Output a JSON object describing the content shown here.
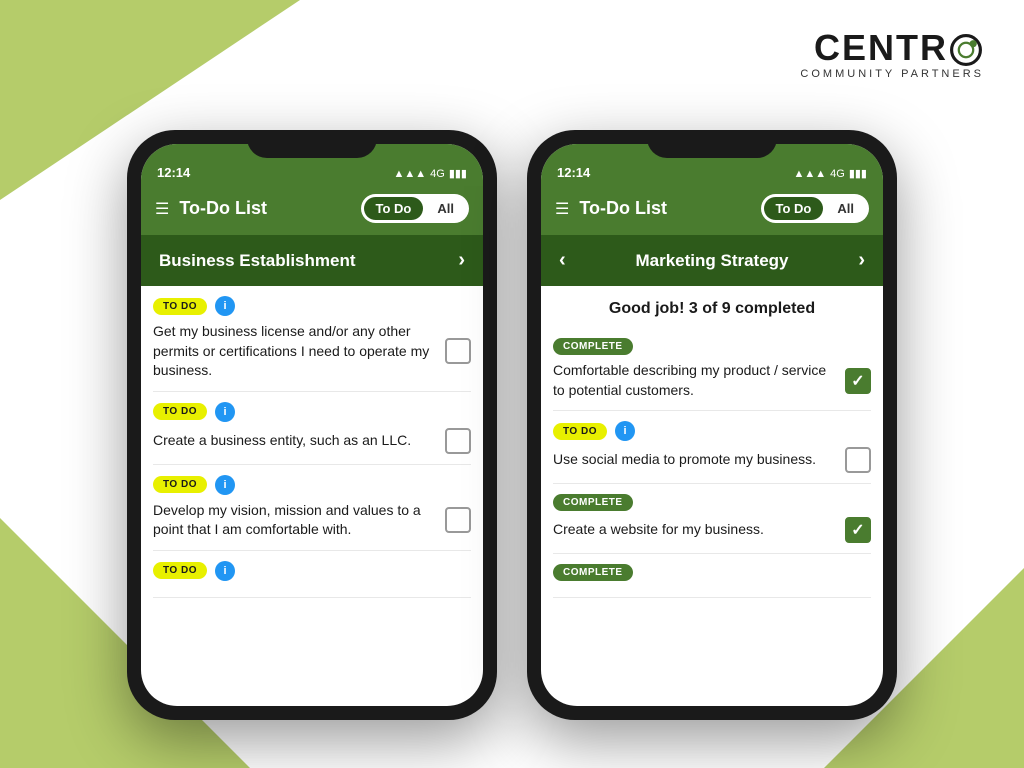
{
  "background": {
    "color": "#ffffff",
    "accent": "#b5cc6a"
  },
  "logo": {
    "text_part1": "CENTR",
    "text_part2": "O",
    "subtitle": "COMMUNITY PARTNERS",
    "accent_color": "#4a7c2f"
  },
  "phone1": {
    "status_time": "12:14",
    "status_signal": "4G",
    "header_title": "To-Do List",
    "tab_todo": "To Do",
    "tab_all": "All",
    "section_title": "Business Establishment",
    "tasks": [
      {
        "badge": "TO DO",
        "badge_type": "todo",
        "has_info": true,
        "text": "Get my business license and/or any other permits or certifications I need to operate my business.",
        "checked": false
      },
      {
        "badge": "TO DO",
        "badge_type": "todo",
        "has_info": true,
        "text": "Create a business entity, such as an LLC.",
        "checked": false
      },
      {
        "badge": "TO DO",
        "badge_type": "todo",
        "has_info": true,
        "text": "Develop my vision, mission and values to a point that I am comfortable with.",
        "checked": false
      },
      {
        "badge": "TO DO",
        "badge_type": "todo",
        "has_info": true,
        "text": "",
        "checked": false
      }
    ]
  },
  "phone2": {
    "status_time": "12:14",
    "status_signal": "4G",
    "header_title": "To-Do List",
    "tab_todo": "To Do",
    "tab_all": "All",
    "section_title": "Marketing Strategy",
    "progress_text": "Good job! 3 of 9 completed",
    "tasks": [
      {
        "badge": "COMPLETE",
        "badge_type": "complete",
        "has_info": false,
        "text": "Comfortable describing my product / service to potential customers.",
        "checked": true
      },
      {
        "badge": "TO DO",
        "badge_type": "todo",
        "has_info": true,
        "text": "Use social media to promote my business.",
        "checked": false
      },
      {
        "badge": "COMPLETE",
        "badge_type": "complete",
        "has_info": false,
        "text": "Create a website for my business.",
        "checked": true
      },
      {
        "badge": "COMPLETE",
        "badge_type": "complete",
        "has_info": false,
        "text": "",
        "checked": true
      }
    ]
  }
}
